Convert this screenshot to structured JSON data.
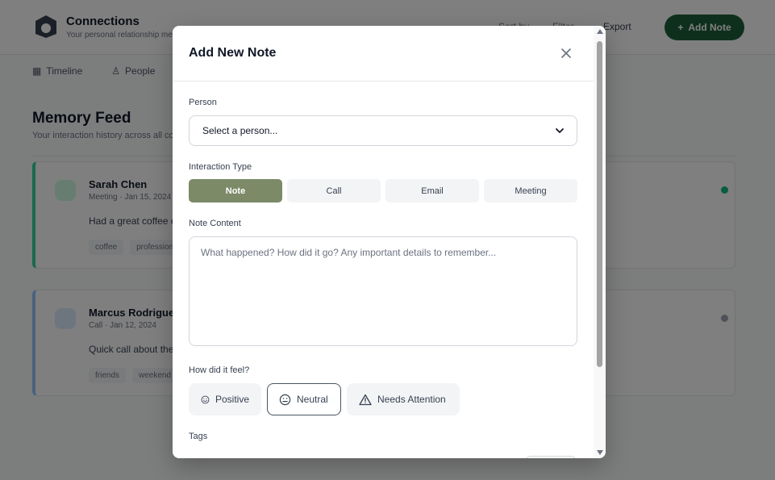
{
  "background": {
    "brand_name": "Connections",
    "brand_subtitle": "Your personal relationship memory",
    "nav": [
      "Sort by",
      "Filter",
      "Export"
    ],
    "add_button_label": "Add Note",
    "tabs": [
      {
        "icon": "grid-icon",
        "label": "Timeline"
      },
      {
        "icon": "person-icon",
        "label": "People"
      }
    ],
    "feed_title": "Memory Feed",
    "feed_subtitle": "Your interaction history across all connections",
    "cards": [
      {
        "name": "Sarah Chen",
        "meta": "Meeting · Jan 15, 2024",
        "text": "Had a great coffee chat about her new project and upcoming product launch deadline.",
        "tags": [
          "coffee",
          "professional"
        ]
      },
      {
        "name": "Marcus Rodriguez",
        "meta": "Call · Jan 12, 2024",
        "text": "Quick call about the weekend plans.",
        "tags": [
          "friends",
          "weekend"
        ]
      }
    ]
  },
  "modal": {
    "title": "Add New Note",
    "person_label": "Person",
    "person_select_value": "Select a person...",
    "interaction_type_label": "Interaction Type",
    "interaction_types": [
      "Note",
      "Call",
      "Email",
      "Meeting"
    ],
    "selected_interaction_type": "Note",
    "content_label": "Note Content",
    "content_placeholder": "What happened? How did it go? Any important details to remember...",
    "feel_label": "How did it feel?",
    "feel_options": [
      {
        "label": "Positive",
        "icon": "smile-icon"
      },
      {
        "label": "Neutral",
        "icon": "neutral-face-icon"
      },
      {
        "label": "Needs Attention",
        "icon": "warning-triangle-icon"
      }
    ],
    "selected_feel": "Neutral",
    "tags_label": "Tags"
  },
  "colors": {
    "accent": "#7c8a68",
    "brand_green": "#1f5f3a",
    "overlay": "rgba(0,0,0,0.5)"
  }
}
